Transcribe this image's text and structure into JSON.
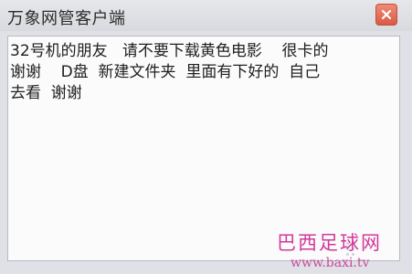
{
  "window": {
    "title": "万象网管客户端"
  },
  "message": {
    "text": "32号机的朋友   请不要下载黄色电影    很卡的\n谢谢    D盘  新建文件夹  里面有下好的  自己\n去看  谢谢"
  },
  "watermark": {
    "text_cn": "巴西足球网",
    "url": "www.baxi.tv",
    "color": "#d2389a"
  },
  "colors": {
    "close_button": "#d75b45"
  }
}
